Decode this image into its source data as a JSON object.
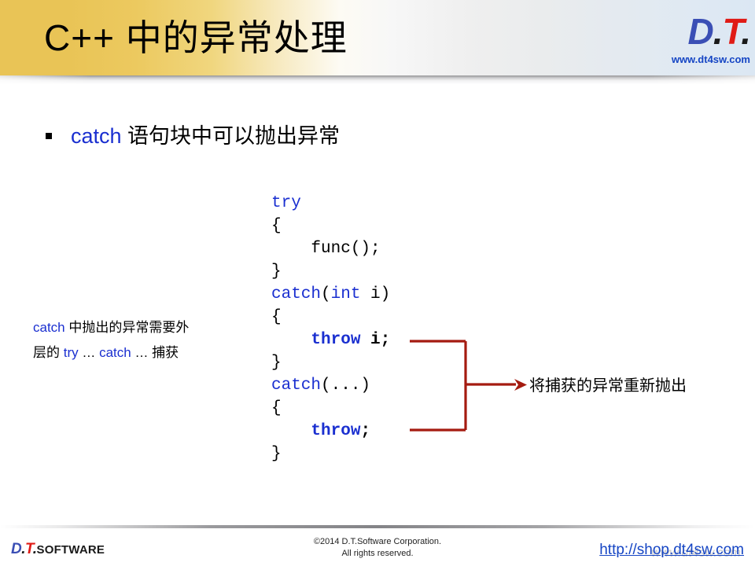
{
  "slide": {
    "title": "C++ 中的异常处理",
    "accent_gold": "#e9c456",
    "accent_blue": "#1a2fd0",
    "accent_red": "#a51b10"
  },
  "header_logo": {
    "d": "D",
    "dot1": ".",
    "t": "T",
    "dot2": ".",
    "url": "www.dt4sw.com"
  },
  "bullet": {
    "keyword": "catch",
    "text": " 语句块中可以抛出异常"
  },
  "code": {
    "lines": [
      {
        "tokens": [
          {
            "t": "try",
            "c": "blue",
            "b": false
          }
        ]
      },
      {
        "tokens": [
          {
            "t": "{",
            "c": "black",
            "b": false
          }
        ]
      },
      {
        "tokens": [
          {
            "t": "    func();",
            "c": "black",
            "b": false
          }
        ]
      },
      {
        "tokens": [
          {
            "t": "}",
            "c": "black",
            "b": false
          }
        ]
      },
      {
        "tokens": [
          {
            "t": "catch",
            "c": "blue",
            "b": false
          },
          {
            "t": "(",
            "c": "black",
            "b": false
          },
          {
            "t": "int",
            "c": "blue",
            "b": false
          },
          {
            "t": " i)",
            "c": "black",
            "b": false
          }
        ]
      },
      {
        "tokens": [
          {
            "t": "{",
            "c": "black",
            "b": false
          }
        ]
      },
      {
        "tokens": [
          {
            "t": "    ",
            "c": "black",
            "b": false
          },
          {
            "t": "throw",
            "c": "blue",
            "b": true
          },
          {
            "t": " i;",
            "c": "black",
            "b": true
          }
        ]
      },
      {
        "tokens": [
          {
            "t": "}",
            "c": "black",
            "b": false
          }
        ]
      },
      {
        "tokens": [
          {
            "t": "catch",
            "c": "blue",
            "b": false
          },
          {
            "t": "(...)",
            "c": "black",
            "b": false
          }
        ]
      },
      {
        "tokens": [
          {
            "t": "{",
            "c": "black",
            "b": false
          }
        ]
      },
      {
        "tokens": [
          {
            "t": "    ",
            "c": "black",
            "b": false
          },
          {
            "t": "throw",
            "c": "blue",
            "b": true
          },
          {
            "t": ";",
            "c": "black",
            "b": true
          }
        ]
      },
      {
        "tokens": [
          {
            "t": "}",
            "c": "black",
            "b": false
          }
        ]
      }
    ]
  },
  "note_left": {
    "line1_kw": "catch",
    "line1_rest": " 中抛出的异常需要外",
    "line2_pre": "层的 ",
    "line2_kw1": "try",
    "line2_mid1": " … ",
    "line2_kw2": "catch",
    "line2_mid2": " … ",
    "line2_end": "捕获"
  },
  "note_right": {
    "text": "将捕获的异常重新抛出"
  },
  "footer": {
    "logo_d": "D",
    "logo_dot1": ".",
    "logo_t": "T",
    "logo_dot2": ".",
    "logo_word": "SOFTWARE",
    "copyright_line1": "©2014 D.T.Software Corporation.",
    "copyright_line2": "All rights reserved.",
    "link": "http://shop.dt4sw.com",
    "watermark": "www.dt4sw.com"
  }
}
